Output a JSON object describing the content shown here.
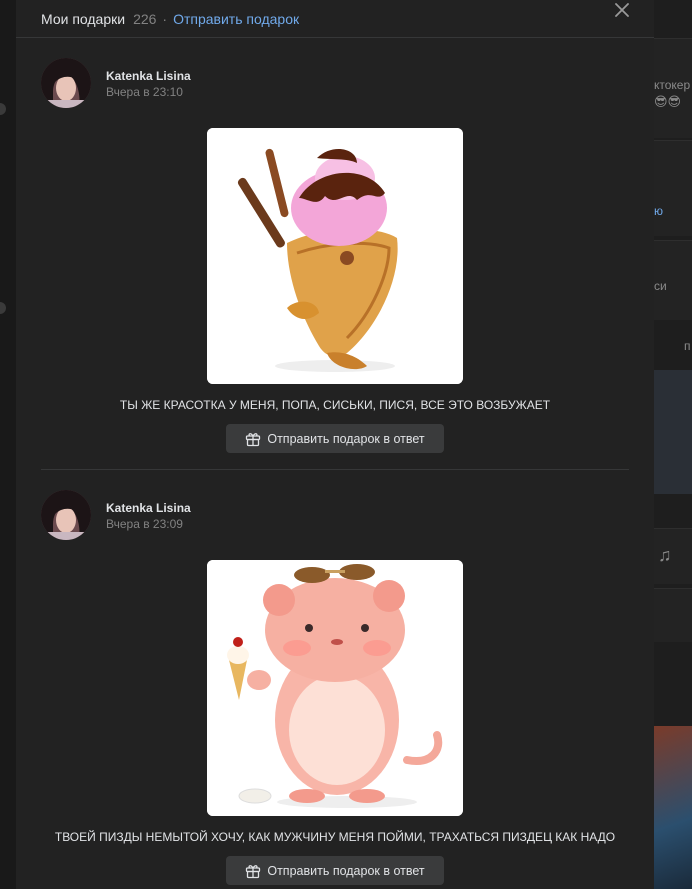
{
  "modal": {
    "title": "Мои подарки",
    "count": "226",
    "separator": "·",
    "send_gift_link": "Отправить подарок"
  },
  "gifts": [
    {
      "author": "Katenka Lisina",
      "time": "Вчера в 23:10",
      "image": "ice-cream-taiyaki",
      "message": "ТЫ ЖЕ КРАСОТКА У МЕНЯ, ПОПА, СИСЬКИ, ПИСЯ, ВСЕ ЭТО ВОЗБУЖАЕТ",
      "reply_label": "Отправить подарок в ответ"
    },
    {
      "author": "Katenka Lisina",
      "time": "Вчера в 23:09",
      "image": "hamster-with-ice-cream",
      "message": "ТВОЕЙ ПИЗДЫ НЕМЫТОЙ ХОЧУ, КАК МУЖЧИНУ МЕНЯ ПОЙМИ, ТРАХАТЬСЯ ПИЗДЕЦ КАК НАДО",
      "reply_label": "Отправить подарок в ответ"
    }
  ],
  "background": {
    "snippet_1": "ктокер",
    "snippet_2": "ю",
    "snippet_3": "си",
    "snippet_4": "п"
  },
  "colors": {
    "modal_bg": "#222222",
    "link": "#71aaeb",
    "button_bg": "#3a3b3c",
    "muted_text": "#828282"
  }
}
